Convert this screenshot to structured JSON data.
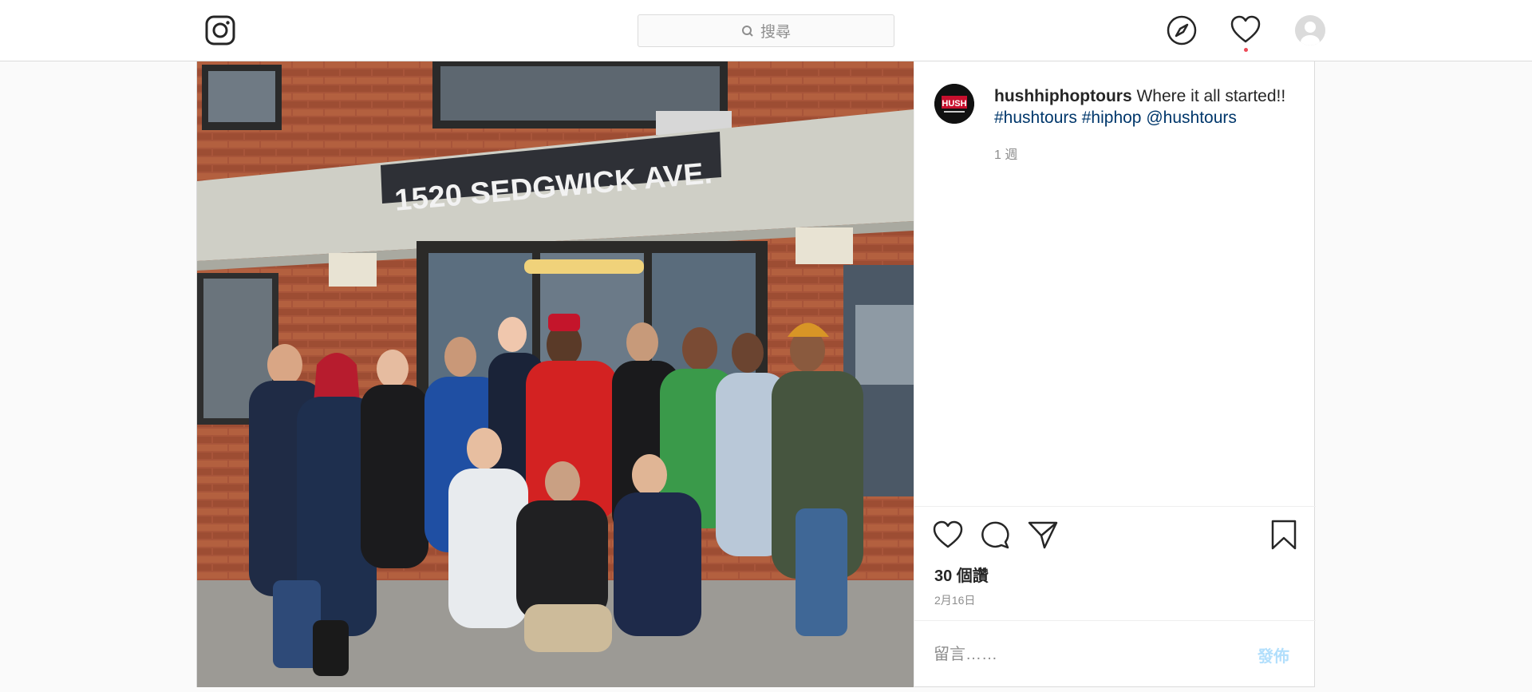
{
  "header": {
    "search_placeholder": "搜尋",
    "icons": {
      "logo": "instagram-logo-icon",
      "search": "search-icon",
      "explore": "compass-icon",
      "activity": "heart-icon",
      "profile": "avatar"
    }
  },
  "post": {
    "photo": {
      "sign_text": "1520 SEDGWICK AVE."
    },
    "author": {
      "username": "hushhiphoptours",
      "avatar_text": "HUSH"
    },
    "caption": {
      "text": " Where it all started!!",
      "hashtags": [
        "#hushtours",
        "#hiphop",
        "@hushtours"
      ]
    },
    "time_ago": "1 週",
    "likes": "30 個讚",
    "date": "2月16日",
    "comment": {
      "placeholder": "留言……",
      "post_label": "發佈"
    },
    "colors": {
      "link": "#00376b",
      "post_button_disabled": "#b2dffc",
      "notification": "#ed4956"
    }
  }
}
